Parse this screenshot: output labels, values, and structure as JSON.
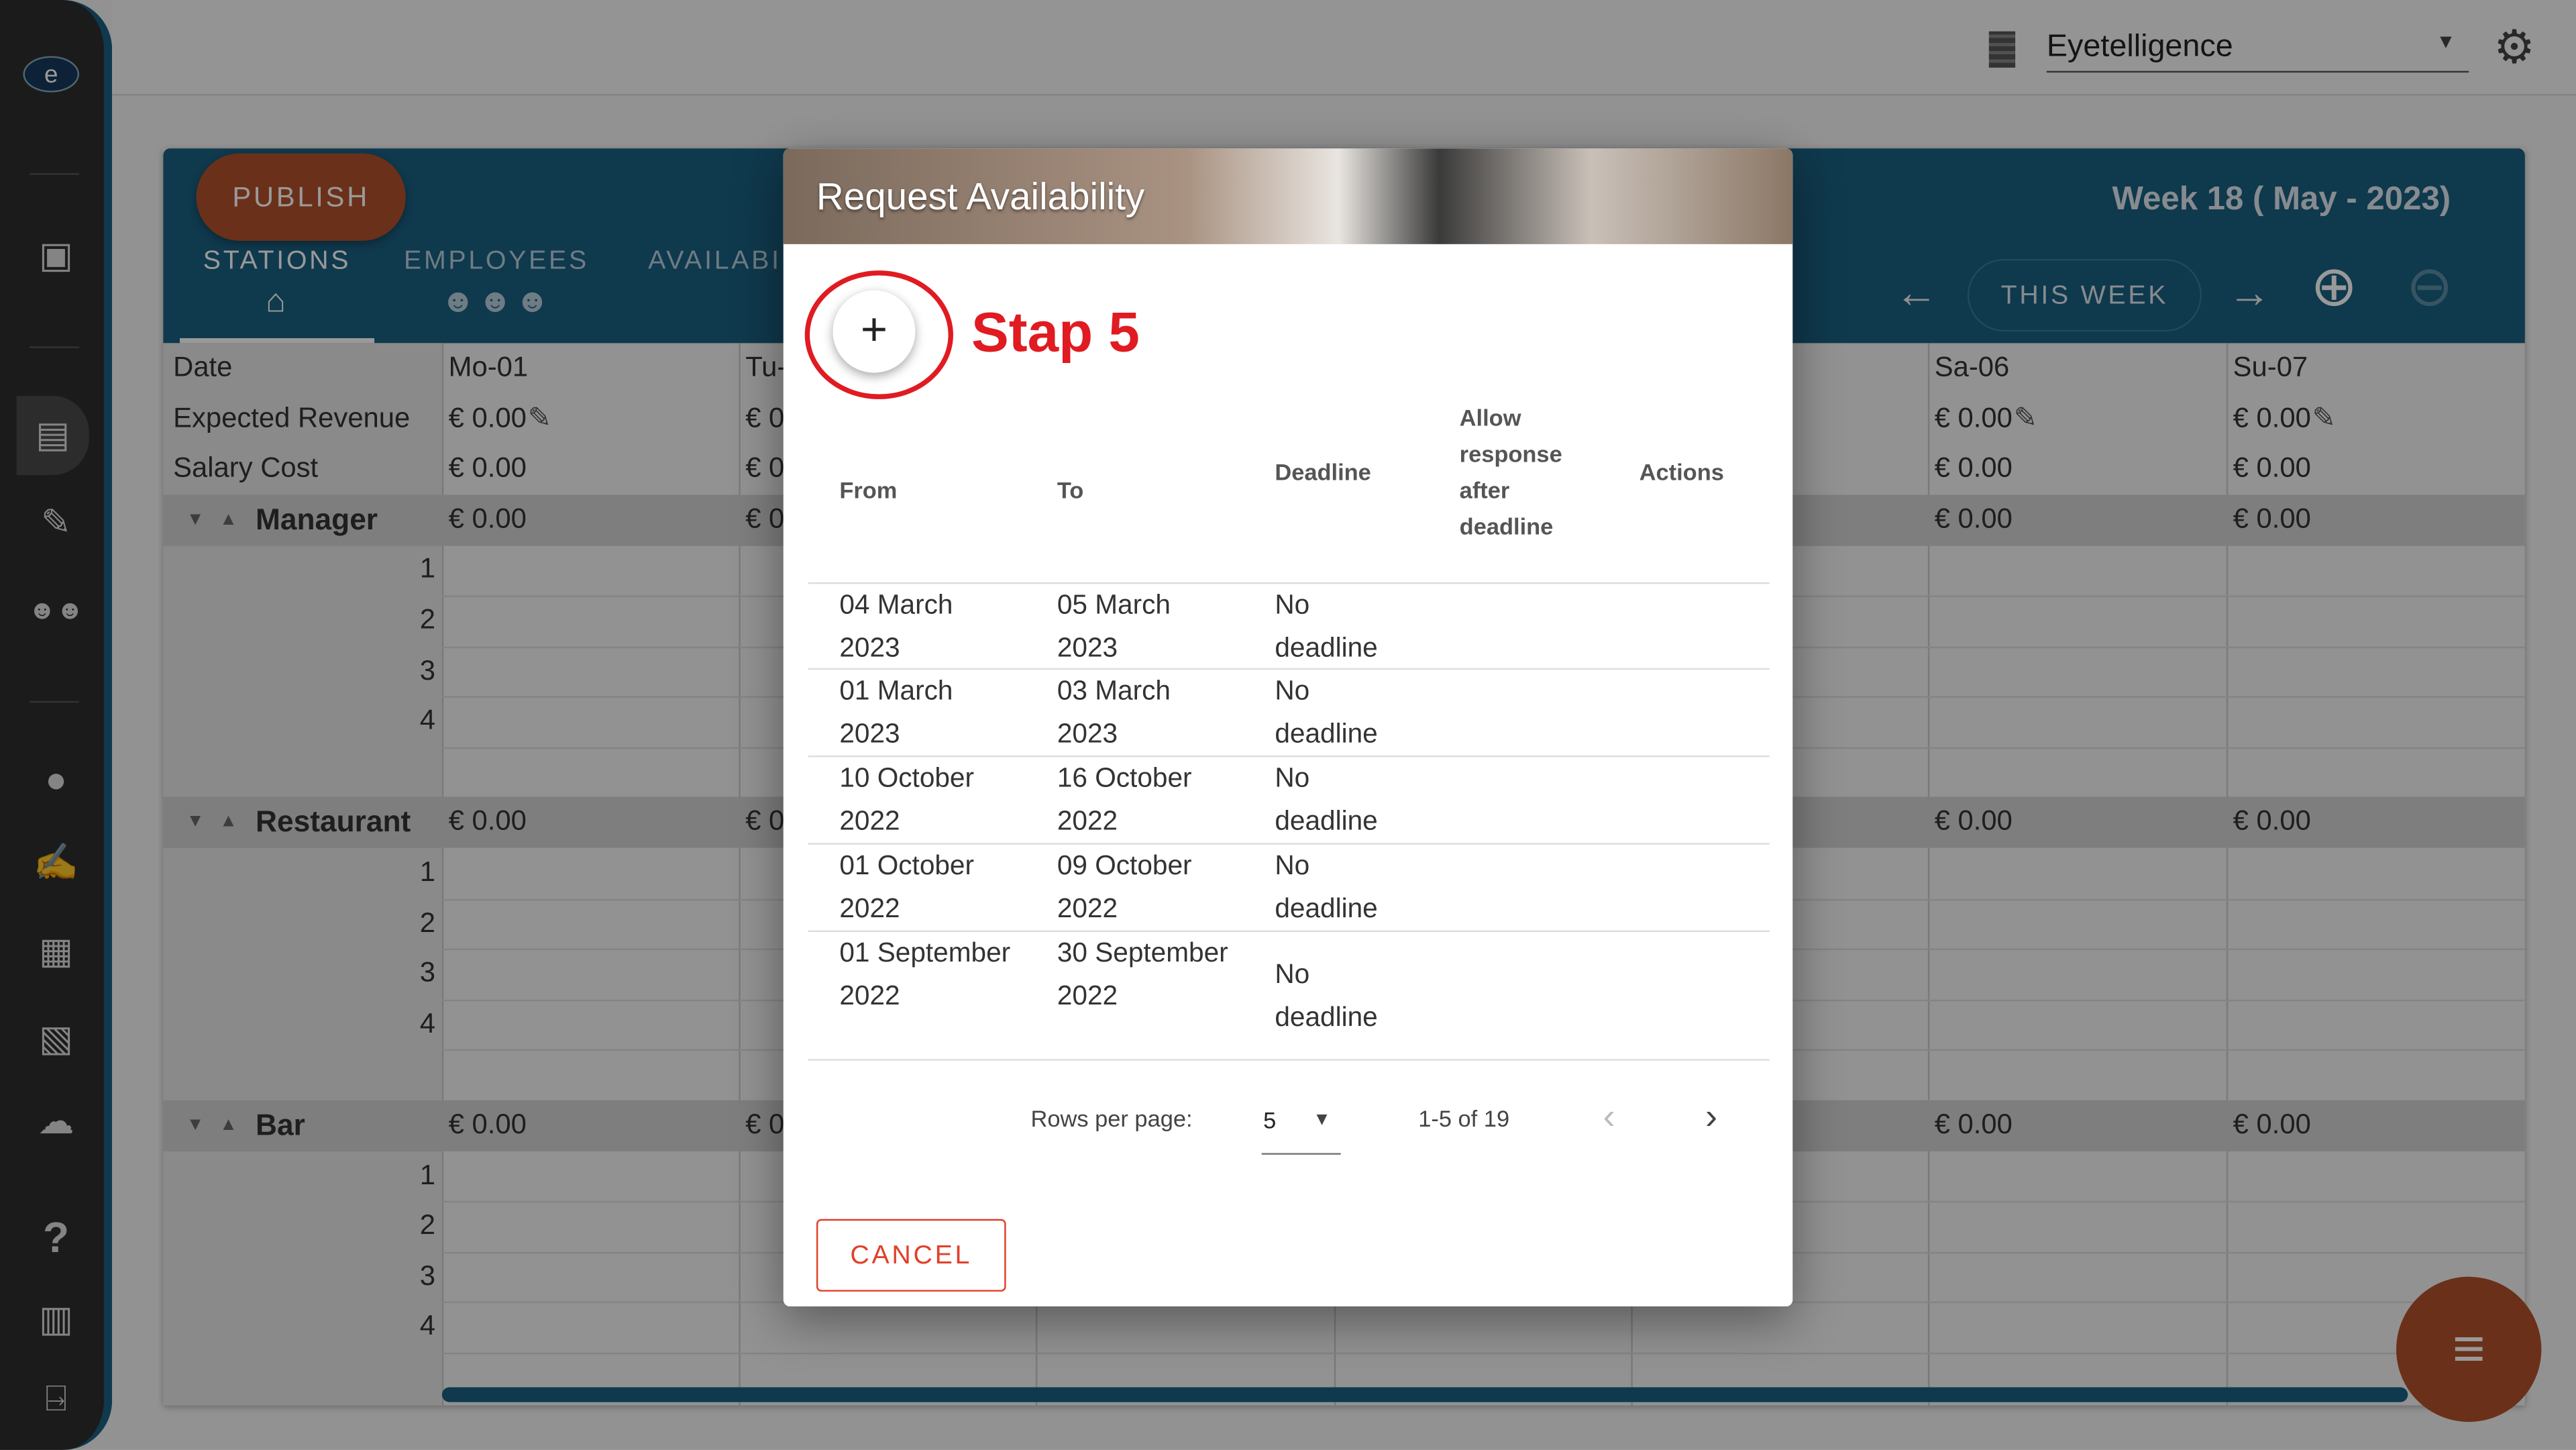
{
  "sidebar": {
    "logo": "eye-logo",
    "items": [
      "calendar-icon",
      "schedule-icon",
      "edit-calendar-icon",
      "team-icon",
      "person-icon",
      "document-edit-icon",
      "cash-register-icon",
      "id-card-icon",
      "cloud-icon",
      "help-icon",
      "manual-icon",
      "exit-icon"
    ]
  },
  "topbar": {
    "company": "Eyetelligence"
  },
  "header": {
    "publish": "PUBLISH",
    "tabs": [
      "STATIONS",
      "EMPLOYEES",
      "AVAILABILITY"
    ],
    "week": "Week 18 ( May - 2023)",
    "this_week": "THIS WEEK"
  },
  "grid": {
    "labels": {
      "date": "Date",
      "revenue": "Expected Revenue",
      "salary": "Salary Cost"
    },
    "days": [
      {
        "name": "Mo-01",
        "revenue": "€ 0.00",
        "salary": "€ 0.00",
        "groups": [
          "€ 0.00",
          "€ 0.00",
          "€ 0.00"
        ]
      },
      {
        "name": "Tu-",
        "revenue": "€ 0",
        "salary": "€ 0",
        "groups": [
          "€ 0",
          "€ 0",
          "€ 0"
        ]
      },
      {
        "name": "Sa-06",
        "revenue": "€ 0.00",
        "salary": "€ 0.00",
        "groups": [
          "€ 0.00",
          "€ 0.00",
          "€ 0.00"
        ]
      },
      {
        "name": "Su-07",
        "revenue": "€ 0.00",
        "salary": "€ 0.00",
        "groups": [
          "€ 0.00",
          "€ 0.00",
          "€ 0.00"
        ]
      }
    ],
    "groups": [
      {
        "name": "Manager",
        "rows": [
          "1",
          "2",
          "3",
          "4"
        ]
      },
      {
        "name": "Restaurant",
        "rows": [
          "1",
          "2",
          "3",
          "4"
        ]
      },
      {
        "name": "Bar",
        "rows": [
          "1",
          "2",
          "3",
          "4"
        ]
      }
    ]
  },
  "modal": {
    "title": "Request Availability",
    "annotation": "Stap 5",
    "columns": [
      "From",
      "To",
      "Deadline",
      "Allow response after deadline",
      "Actions"
    ],
    "rows": [
      {
        "from": "04 March 2023",
        "to": "05 March 2023",
        "deadline": "No deadline"
      },
      {
        "from": "01 March 2023",
        "to": "03 March 2023",
        "deadline": "No deadline"
      },
      {
        "from": "10 October 2022",
        "to": "16 October 2022",
        "deadline": "No deadline"
      },
      {
        "from": "01 October 2022",
        "to": "09 October 2022",
        "deadline": "No deadline"
      },
      {
        "from": "01 September 2022",
        "to": "30 September 2022",
        "deadline": "No deadline"
      }
    ],
    "rows_per_page_label": "Rows per page:",
    "rows_per_page": "5",
    "range": "1-5 of 19",
    "cancel": "CANCEL"
  },
  "colors": {
    "header": "#1a5f80",
    "publish": "#b3502a",
    "annotation": "#e01b22",
    "cancel": "#e0412a"
  }
}
